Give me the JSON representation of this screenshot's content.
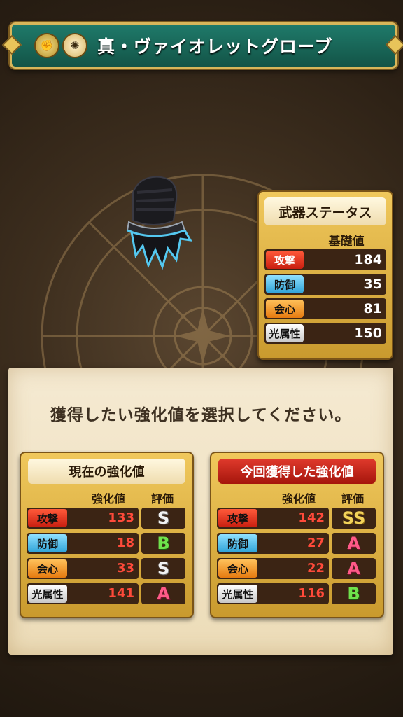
{
  "title": {
    "icons": [
      "glove-category-icon",
      "light-element-icon"
    ],
    "text": "真・ヴァイオレットグローブ"
  },
  "weapon_status": {
    "heading": "武器ステータス",
    "column": "基礎値",
    "rows": [
      {
        "label": "攻撃",
        "value": "184",
        "color": "#d0281a"
      },
      {
        "label": "防御",
        "value": "35",
        "color": "#3fb4e6"
      },
      {
        "label": "会心",
        "value": "81",
        "color": "#f0951f"
      },
      {
        "label": "光属性",
        "value": "150",
        "color": "#e8e8e8"
      }
    ]
  },
  "instruction": "獲得したい強化値を選択してください。",
  "current": {
    "heading": "現在の強化値",
    "col_value": "強化値",
    "col_grade": "評価",
    "rows": [
      {
        "label": "攻撃",
        "value": "133",
        "grade": "S"
      },
      {
        "label": "防御",
        "value": "18",
        "grade": "B"
      },
      {
        "label": "会心",
        "value": "33",
        "grade": "S"
      },
      {
        "label": "光属性",
        "value": "141",
        "grade": "A"
      }
    ]
  },
  "new": {
    "heading": "今回獲得した強化値",
    "col_value": "強化値",
    "col_grade": "評価",
    "rows": [
      {
        "label": "攻撃",
        "value": "142",
        "grade": "SS"
      },
      {
        "label": "防御",
        "value": "27",
        "grade": "A"
      },
      {
        "label": "会心",
        "value": "22",
        "grade": "A"
      },
      {
        "label": "光属性",
        "value": "116",
        "grade": "B"
      }
    ]
  }
}
